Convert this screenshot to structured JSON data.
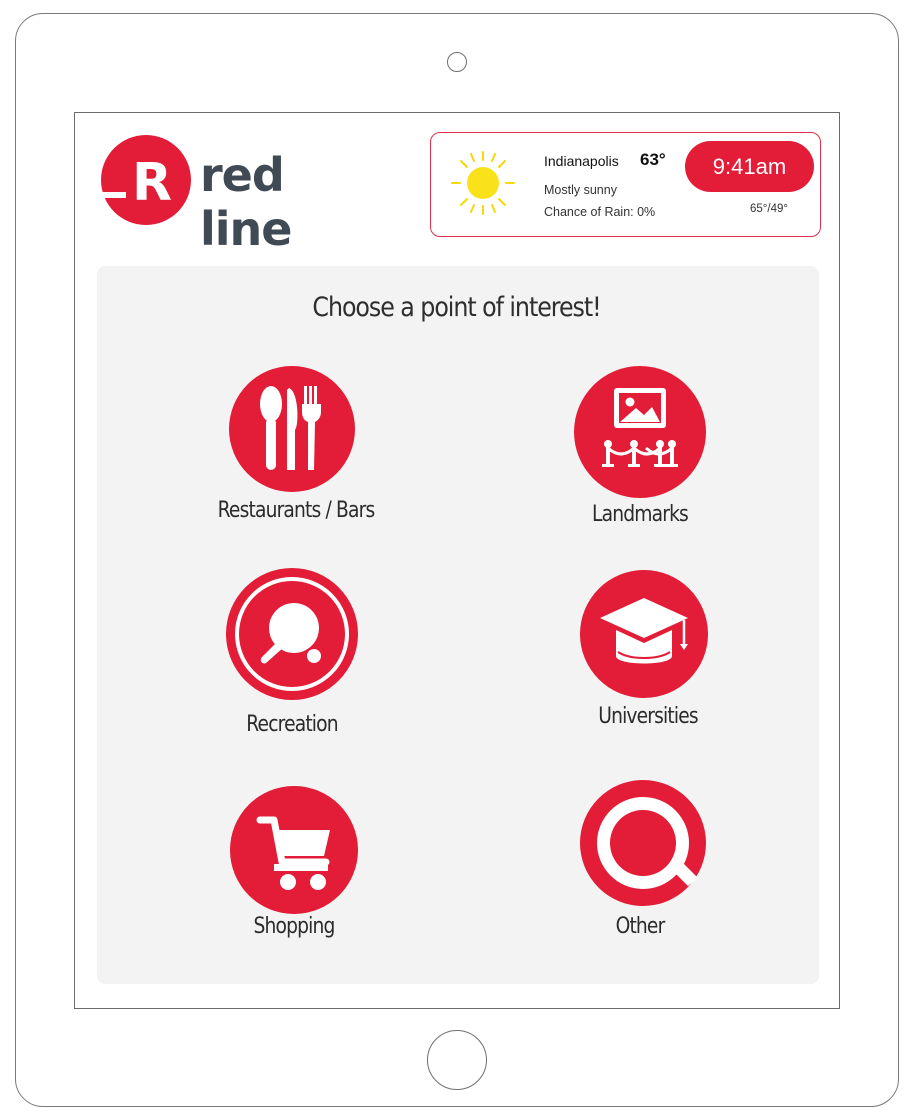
{
  "brand": {
    "name": "red line",
    "mark_letter": "R",
    "color": "#e31c37"
  },
  "weather": {
    "icon": "sun-icon",
    "city": "Indianapolis",
    "temperature": "63°",
    "condition": "Mostly sunny",
    "rain": "Chance of Rain: 0%",
    "time": "9:41am",
    "high_low": "65°/49°"
  },
  "main": {
    "title": "Choose a point of interest!",
    "categories": [
      {
        "label": "Restaurants / Bars",
        "icon": "utensils-icon"
      },
      {
        "label": "Landmarks",
        "icon": "gallery-icon"
      },
      {
        "label": "Recreation",
        "icon": "ping-pong-icon"
      },
      {
        "label": "Universities",
        "icon": "graduation-cap-icon"
      },
      {
        "label": "Shopping",
        "icon": "shopping-cart-icon"
      },
      {
        "label": "Other",
        "icon": "search-icon"
      }
    ]
  }
}
